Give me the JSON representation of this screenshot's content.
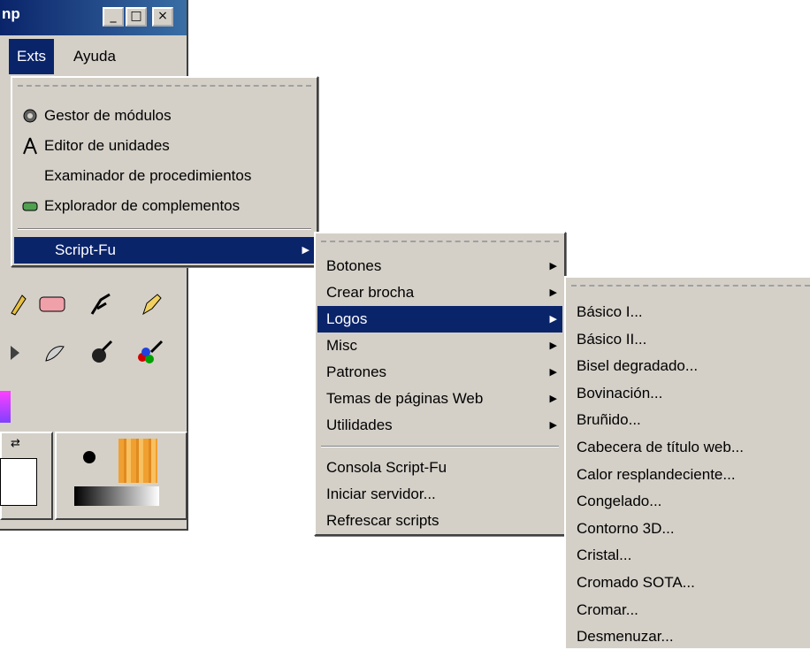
{
  "window": {
    "title_fragment": "np",
    "controls": [
      "_",
      "□",
      "×"
    ],
    "menubar": [
      "Exts",
      "Ayuda"
    ]
  },
  "exts_menu": {
    "items": [
      {
        "label": "Gestor de módulos",
        "icon": "gear-icon"
      },
      {
        "label": "Editor de unidades",
        "icon": "compass-icon"
      },
      {
        "label": "Examinador de procedimientos",
        "icon": ""
      },
      {
        "label": "Explorador de complementos",
        "icon": "plugin-icon"
      }
    ],
    "submenu": {
      "label": "Script-Fu",
      "arrow": "▶"
    }
  },
  "scriptfu_menu": {
    "submenus": [
      "Botones",
      "Crear brocha",
      "Logos",
      "Misc",
      "Patrones",
      "Temas de páginas Web",
      "Utilidades"
    ],
    "selected": "Logos",
    "items": [
      "Consola Script-Fu",
      "Iniciar servidor...",
      "Refrescar scripts"
    ]
  },
  "logos_menu": {
    "items": [
      "Básico I...",
      "Básico II...",
      "Bisel degradado...",
      "Bovinación...",
      "Bruñido...",
      "Cabecera de título web...",
      "Calor resplandeciente...",
      "Congelado...",
      "Contorno 3D...",
      "Cristal...",
      "Cromado SOTA...",
      "Cromar...",
      "Desmenuzar..."
    ]
  },
  "colors": {
    "selection": "#0a246a",
    "menu_bg": "#d4d0c8"
  }
}
